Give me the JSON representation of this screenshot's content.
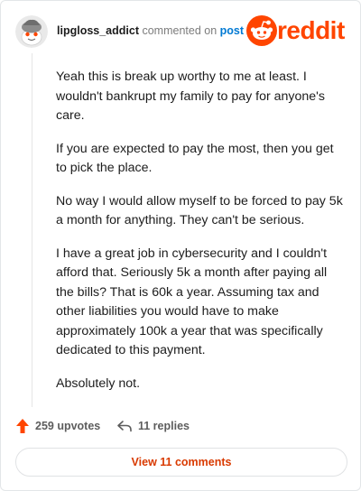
{
  "header": {
    "username": "lipgloss_addict",
    "verb": "commented on",
    "post_link": "post",
    "logo_text": "reddit"
  },
  "comment": {
    "paragraphs": [
      "Yeah this is break up worthy to me at least. I wouldn't bankrupt my family to pay for anyone's care.",
      "If you are expected to pay the most, then you get to pick the place.",
      "No way I would allow myself to be forced to pay 5k a month for anything. They can't be serious.",
      "I have a great job in cybersecurity and I couldn't afford that. Seriously 5k a month after paying all the bills? That is 60k a year. Assuming tax and other liabilities you would have to make approximately 100k a year that was specifically dedicated to this payment.",
      "Absolutely not."
    ]
  },
  "actions": {
    "upvotes": "259 upvotes",
    "replies": "11 replies",
    "upvote_icon": "upvote-arrow-icon",
    "reply_icon": "reply-arrow-icon"
  },
  "footer": {
    "view_comments": "View 11 comments"
  },
  "colors": {
    "brand": "#ff4500",
    "link": "#0079d3",
    "view_button_text": "#d93a00"
  }
}
